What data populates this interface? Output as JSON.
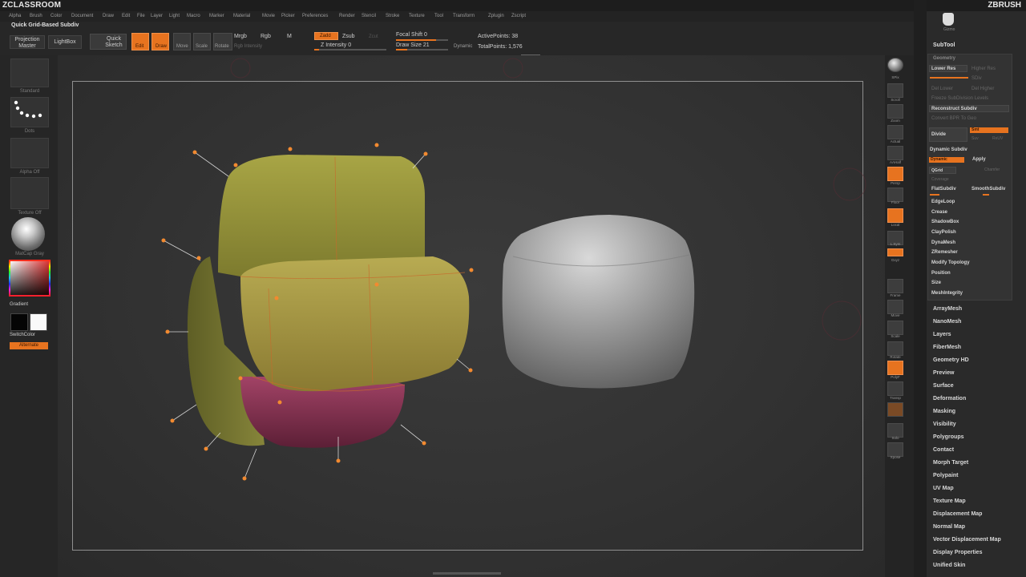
{
  "app": {
    "brand_left": "ZCLASSROOM",
    "brand_right": "ZBRUSH"
  },
  "menu": [
    "Alpha",
    "Brush",
    "Color",
    "Document",
    "Draw",
    "Edit",
    "File",
    "Layer",
    "Light",
    "Macro",
    "Marker",
    "Material",
    "Movie",
    "Picker",
    "Preferences",
    "Render",
    "Stencil",
    "Stroke",
    "Texture",
    "Tool",
    "Transform",
    "Zplugin",
    "Zscript"
  ],
  "shelf": {
    "quick_grid": "Quick Grid-Based Subdiv",
    "projection_master": "Projection Master",
    "lightbox": "LightBox",
    "quick_sketch": "Quick Sketch",
    "edit": "Edit",
    "draw": "Draw",
    "move": "Move",
    "scale": "Scale",
    "rotate": "Rotate",
    "mrgb": "Mrgb",
    "rgb": "Rgb",
    "m": "M",
    "rgb_intensity": "Rgb Intensity",
    "zadd": "Zadd",
    "zsub": "Zsub",
    "zcut": "Zcut",
    "z_intensity": "Z Intensity 0",
    "focal_shift": "Focal Shift 0",
    "draw_size": "Draw Size 21",
    "dynamic": "Dynamic",
    "active_points": "ActivePoints: 38",
    "total_points": "TotalPoints: 1,576"
  },
  "left_shelf": {
    "brush": "Standard",
    "stroke": "Dots",
    "alpha": "Alpha Off",
    "texture": "Texture Off",
    "material": "MatCap Gray",
    "gradient": "Gradient",
    "switch_color": "SwitchColor",
    "alternate": "Alternate"
  },
  "right_strip": [
    "SPix",
    "Scroll",
    "Zoom",
    "Actual",
    "AAHalf",
    "Persp",
    "Floor",
    "Local",
    "L.Sym",
    "Gxyz",
    "Frame",
    "Move",
    "Scale",
    "Rotate",
    "PolyF",
    "Transp",
    "Solo",
    "Xpose"
  ],
  "subtool_panel": {
    "top_icon_label": "Gizmo",
    "subtool": "SubTool",
    "geometry": "Geometry",
    "lower_res": "Lower Res",
    "higher_res": "Higher Res",
    "sdiv": "SDiv",
    "del_lower": "Del Lower",
    "del_higher": "Del Higher",
    "freeze_subdiv": "Freeze SubDivision Levels",
    "reconstruct_subdiv": "Reconstruct Subdiv",
    "convert_bpr": "Convert BPR To Geo",
    "divide": "Divide",
    "smt": "Smt",
    "suv": "Suv",
    "rsuv": "ReUV",
    "dynamic_subdiv": "Dynamic Subdiv",
    "dynamic": "Dynamic",
    "apply": "Apply",
    "qgrid": "QGrid",
    "chamfer": "Chamfer",
    "coverage": "Coverage",
    "flat_subdiv": "FlatSubdiv",
    "smooth_subdiv": "SmoothSubdiv",
    "geometry_items": [
      "EdgeLoop",
      "Crease",
      "ShadowBox",
      "ClayPolish",
      "DynaMesh",
      "ZRemesher",
      "Modify Topology",
      "Position",
      "Size",
      "MeshIntegrity"
    ],
    "sections": [
      "ArrayMesh",
      "NanoMesh",
      "Layers",
      "FiberMesh",
      "Geometry HD",
      "Preview",
      "Surface",
      "Deformation",
      "Masking",
      "Visibility",
      "Polygroups",
      "Contact",
      "Morph Target",
      "Polypaint",
      "UV Map",
      "Texture Map",
      "Displacement Map",
      "Normal Map",
      "Vector Displacement Map",
      "Display Properties",
      "Unified Skin"
    ]
  },
  "colors": {
    "accent": "#e7731f",
    "mesh_olive": "#9b9a3e",
    "mesh_magenta": "#8a3555",
    "mesh_gray": "#9a9a9a"
  }
}
